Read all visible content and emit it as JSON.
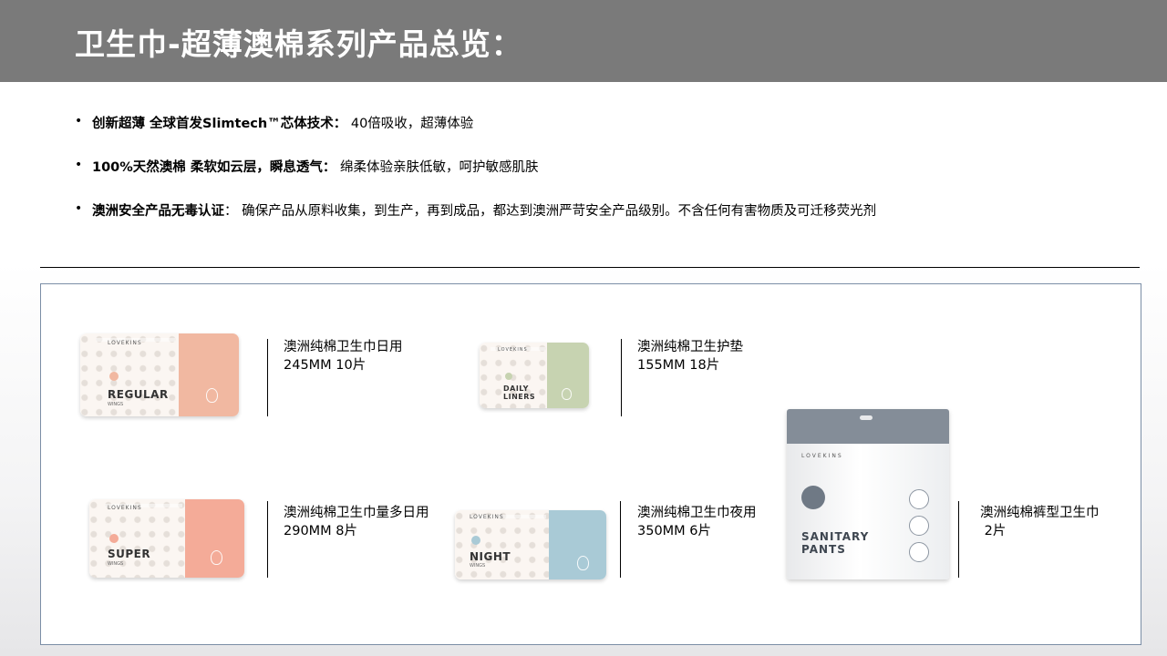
{
  "header": {
    "title": "卫生巾-超薄澳棉系列产品总览："
  },
  "features": [
    {
      "bold": "创新超薄 全球首发Slimtech™芯体技术：",
      "text": " 40倍吸收，超薄体验"
    },
    {
      "bold": "100%天然澳棉 柔软如云层，瞬息透气：",
      "text": " 绵柔体验亲肤低敏，呵护敏感肌肤"
    },
    {
      "bold": "澳洲安全产品无毒认证",
      "text": "：  确保产品从原料收集，到生产，再到成品，都达到澳洲严苛安全产品级别。不含任何有害物质及可迁移荧光剂"
    }
  ],
  "packaging_text": {
    "brand": "LOVEKINS",
    "regular": "REGULAR",
    "daily": "DAILY",
    "liners": "LINERS",
    "super": "SUPER",
    "night": "NIGHT",
    "wings": "WINGS",
    "sanitary": "SANITARY",
    "pants": "PANTS"
  },
  "products": [
    {
      "name": "澳洲纯棉卫生巾日用",
      "spec": "245MM 10片",
      "accent": "#f1b8a1"
    },
    {
      "name": "澳洲纯棉卫生护垫",
      "spec": "155MM 18片",
      "accent": "#c7d3b1"
    },
    {
      "name": "澳洲纯棉卫生巾量多日用",
      "spec": "290MM 8片",
      "accent": "#f4ab98"
    },
    {
      "name": "澳洲纯棉卫生巾夜用",
      "spec": "350MM 6片",
      "accent": "#a9cad6"
    },
    {
      "name": "澳洲纯棉裤型卫生巾",
      "spec": " 2片",
      "accent": "#848d98"
    }
  ]
}
